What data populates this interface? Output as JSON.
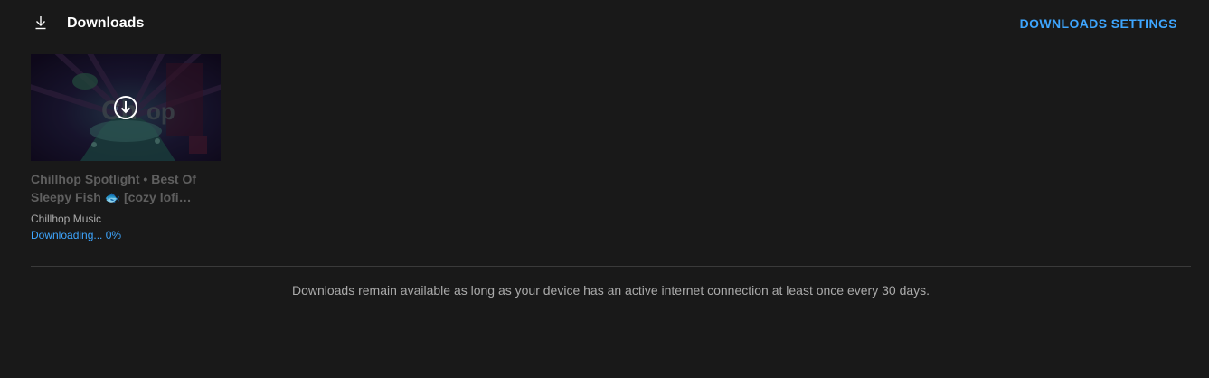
{
  "header": {
    "icon": "download-icon",
    "title": "Downloads",
    "settings_label": "DOWNLOADS SETTINGS"
  },
  "downloads": [
    {
      "thumbnail_icon": "download-circle-icon",
      "title": "Chillhop Spotlight • Best Of Sleepy Fish 🐟 [cozy lofi…",
      "channel": "Chillhop Music",
      "status": "Downloading... 0%",
      "progress": 0
    }
  ],
  "footer": {
    "note": "Downloads remain available as long as your device has an active internet connection at least once every 30 days."
  },
  "colors": {
    "background": "#191919",
    "accent": "#3ea6ff",
    "text_primary": "#ffffff",
    "text_secondary": "#aaaaaa"
  }
}
